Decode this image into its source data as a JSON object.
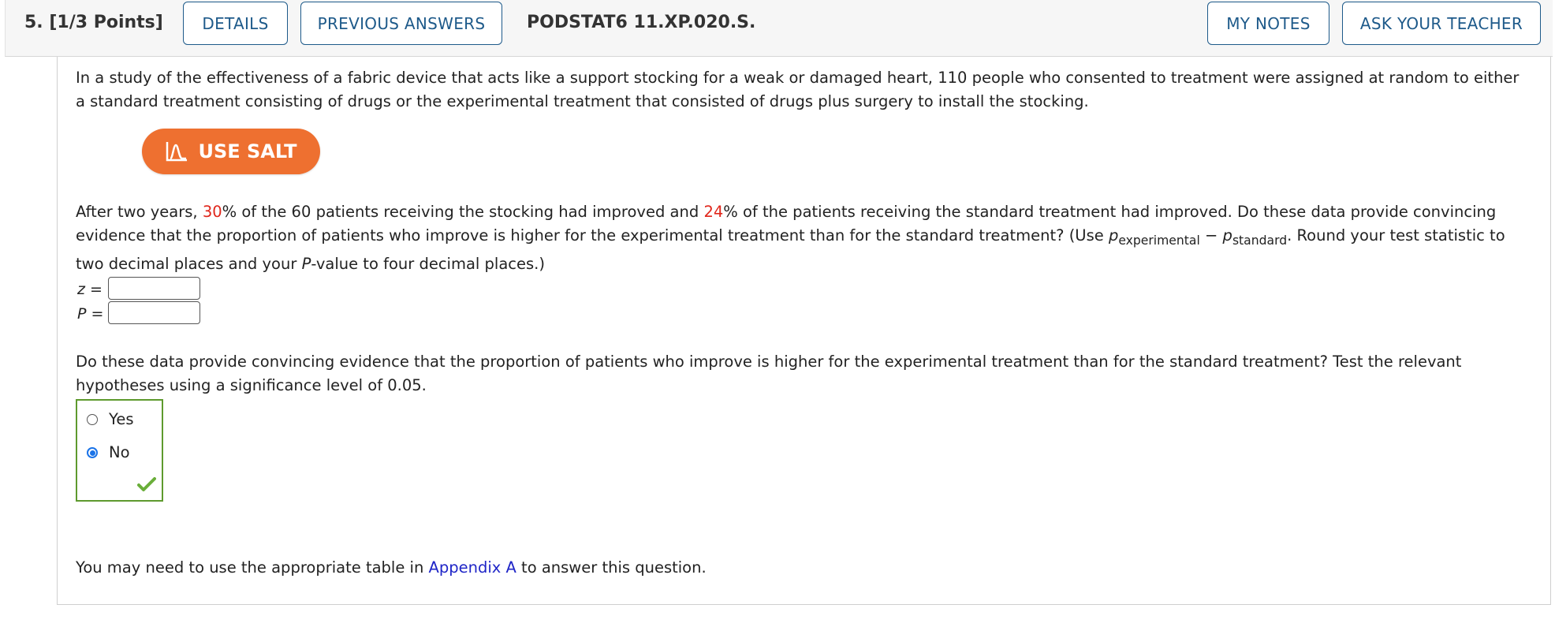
{
  "header": {
    "question_number": "5.",
    "points": "[1/3 Points]",
    "details_label": "DETAILS",
    "previous_answers_label": "PREVIOUS ANSWERS",
    "question_code": "PODSTAT6 11.XP.020.S.",
    "my_notes_label": "MY NOTES",
    "ask_teacher_label": "ASK YOUR TEACHER"
  },
  "intro": {
    "line1": "In a study of the effectiveness of a fabric device that acts like a support stocking for a weak or damaged heart, 110 people who consented to treatment were assigned at random to either",
    "line2": "a standard treatment consisting of drugs or the experimental treatment that consisted of drugs plus surgery to install the stocking."
  },
  "salt_button": {
    "label": "USE SALT",
    "icon": "salt-graph-icon",
    "color": "#ee7030"
  },
  "question1": {
    "l1_a": "After two years, ",
    "pct1": "30",
    "l1_b": "% of the 60 patients receiving the stocking had improved and ",
    "pct2": "24",
    "l1_c": "% of the patients receiving the standard treatment had improved. Do these data provide convincing",
    "l2_a": "evidence that the proportion of patients who improve is higher for the experimental treatment than for the standard treatment? (Use ",
    "p_var": "p",
    "sub_exp": "experimental",
    "minus": " − ",
    "sub_std": "standard",
    "l2_b": ". Round your test statistic to",
    "l3_a": "two decimal places and your ",
    "l3_italic": "P",
    "l3_b": "-value to four decimal places.)",
    "z_label": "z",
    "p_label": "P",
    "equals": " =",
    "z_value": "",
    "p_value": ""
  },
  "question2": {
    "line1": "Do these data provide convincing evidence that the proportion of patients who improve is higher for the experimental treatment than for the standard treatment? Test the relevant",
    "line2": "hypotheses using a significance level of 0.05.",
    "options": [
      "Yes",
      "No"
    ],
    "selected": "No",
    "status_icon": "checkmark-icon",
    "accent": "#5e9a2e"
  },
  "footer": {
    "text_a": "You may need to use the appropriate table in ",
    "link": "Appendix A",
    "text_b": " to answer this question."
  }
}
